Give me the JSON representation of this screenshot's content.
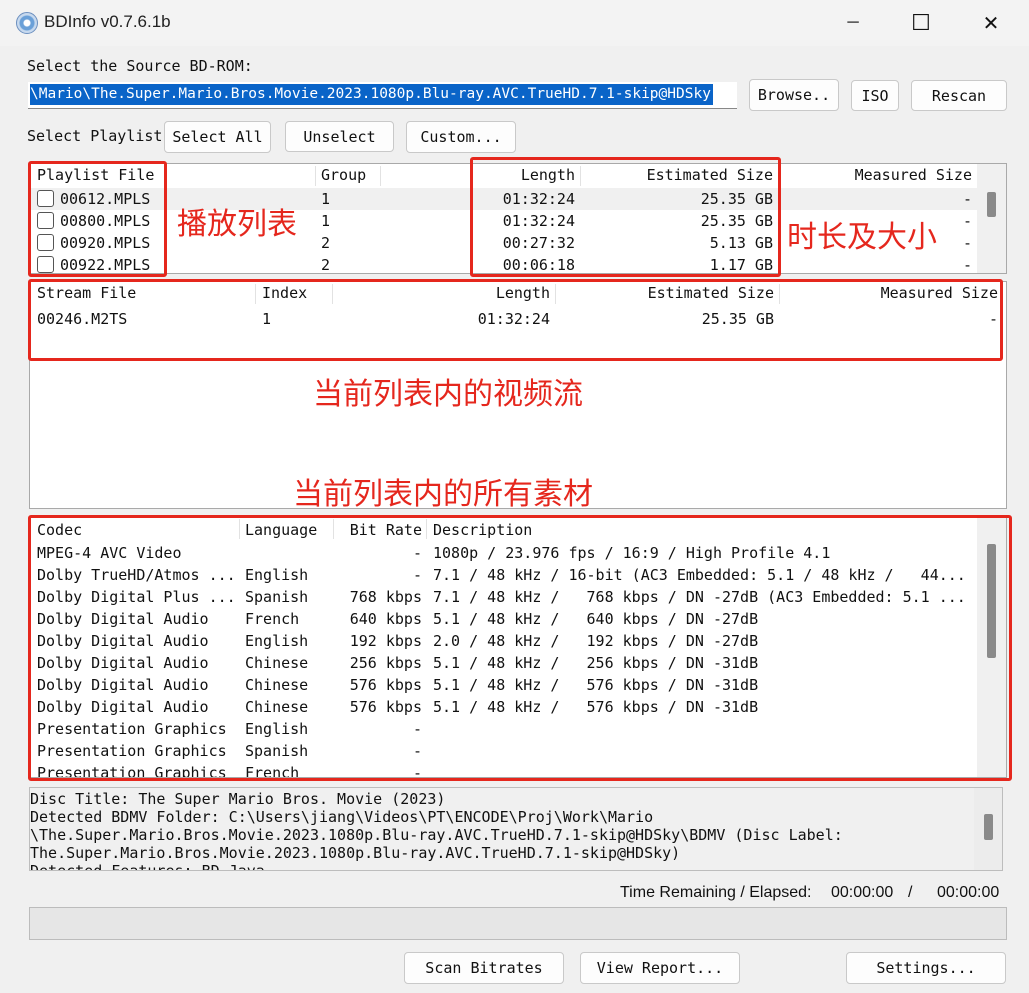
{
  "window": {
    "title": "BDInfo v0.7.6.1b",
    "controls": {
      "minimize": "─",
      "maximize": "☐",
      "close": "✕"
    }
  },
  "source": {
    "label": "Select the Source BD-ROM:",
    "path": "\\Mario\\The.Super.Mario.Bros.Movie.2023.1080p.Blu-ray.AVC.TrueHD.7.1-skip@HDSky",
    "browse": "Browse..",
    "iso": "ISO",
    "rescan": "Rescan"
  },
  "playlist_controls": {
    "label": "Select Playlist",
    "select_all": "Select All",
    "unselect": "Unselect",
    "custom": "Custom..."
  },
  "playlists": {
    "headers": {
      "file": "Playlist File",
      "group": "Group",
      "length": "Length",
      "est_size": "Estimated Size",
      "meas_size": "Measured Size"
    },
    "rows": [
      {
        "file": "00612.MPLS",
        "group": "1",
        "length": "01:32:24",
        "est_size": "25.35 GB",
        "meas_size": "-"
      },
      {
        "file": "00800.MPLS",
        "group": "1",
        "length": "01:32:24",
        "est_size": "25.35 GB",
        "meas_size": "-"
      },
      {
        "file": "00920.MPLS",
        "group": "2",
        "length": "00:27:32",
        "est_size": "5.13 GB",
        "meas_size": "-"
      },
      {
        "file": "00922.MPLS",
        "group": "2",
        "length": "00:06:18",
        "est_size": "1.17 GB",
        "meas_size": "-"
      }
    ]
  },
  "streams": {
    "headers": {
      "file": "Stream File",
      "index": "Index",
      "length": "Length",
      "est_size": "Estimated Size",
      "meas_size": "Measured Size"
    },
    "rows": [
      {
        "file": "00246.M2TS",
        "index": "1",
        "length": "01:32:24",
        "est_size": "25.35 GB",
        "meas_size": "-"
      }
    ]
  },
  "codecs": {
    "headers": {
      "codec": "Codec",
      "language": "Language",
      "bitrate": "Bit Rate",
      "description": "Description"
    },
    "rows": [
      {
        "codec": "MPEG-4 AVC Video",
        "language": "",
        "bitrate": "-",
        "description": "1080p / 23.976 fps / 16:9 / High Profile 4.1"
      },
      {
        "codec": "Dolby TrueHD/Atmos ...",
        "language": "English",
        "bitrate": "-",
        "description": "7.1 / 48 kHz / 16-bit (AC3 Embedded: 5.1 / 48 kHz /   44..."
      },
      {
        "codec": "Dolby Digital Plus ...",
        "language": "Spanish",
        "bitrate": "768 kbps",
        "description": "7.1 / 48 kHz /   768 kbps / DN -27dB (AC3 Embedded: 5.1 ..."
      },
      {
        "codec": "Dolby Digital Audio",
        "language": "French",
        "bitrate": "640 kbps",
        "description": "5.1 / 48 kHz /   640 kbps / DN -27dB"
      },
      {
        "codec": "Dolby Digital Audio",
        "language": "English",
        "bitrate": "192 kbps",
        "description": "2.0 / 48 kHz /   192 kbps / DN -27dB"
      },
      {
        "codec": "Dolby Digital Audio",
        "language": "Chinese",
        "bitrate": "256 kbps",
        "description": "5.1 / 48 kHz /   256 kbps / DN -31dB"
      },
      {
        "codec": "Dolby Digital Audio",
        "language": "Chinese",
        "bitrate": "576 kbps",
        "description": "5.1 / 48 kHz /   576 kbps / DN -31dB"
      },
      {
        "codec": "Dolby Digital Audio",
        "language": "Chinese",
        "bitrate": "576 kbps",
        "description": "5.1 / 48 kHz /   576 kbps / DN -31dB"
      },
      {
        "codec": "Presentation Graphics",
        "language": "English",
        "bitrate": "-",
        "description": ""
      },
      {
        "codec": "Presentation Graphics",
        "language": "Spanish",
        "bitrate": "-",
        "description": ""
      },
      {
        "codec": "Presentation Graphics",
        "language": "French",
        "bitrate": "-",
        "description": ""
      }
    ]
  },
  "log": {
    "lines": [
      "Disc Title: The Super Mario Bros. Movie (2023)",
      "Detected BDMV Folder: C:\\Users\\jiang\\Videos\\PT\\ENCODE\\Proj\\Work\\Mario",
      "\\The.Super.Mario.Bros.Movie.2023.1080p.Blu-ray.AVC.TrueHD.7.1-skip@HDSky\\BDMV (Disc Label:",
      "The.Super.Mario.Bros.Movie.2023.1080p.Blu-ray.AVC.TrueHD.7.1-skip@HDSky)",
      "Detected Features: BD-Java"
    ]
  },
  "status": {
    "time_label": "Time Remaining / Elapsed:",
    "remaining": "00:00:00",
    "slash": "/",
    "elapsed": "00:00:00",
    "progress": 0
  },
  "bottom_buttons": {
    "scan": "Scan Bitrates",
    "report": "View Report...",
    "settings": "Settings..."
  },
  "annotations": {
    "playlist": "播放列表",
    "length_size": "时长及大小",
    "streams": "当前列表内的视频流",
    "all_material": "当前列表内的所有素材"
  },
  "colors": {
    "highlight": "#e5271d",
    "selection": "#0a64c8"
  }
}
